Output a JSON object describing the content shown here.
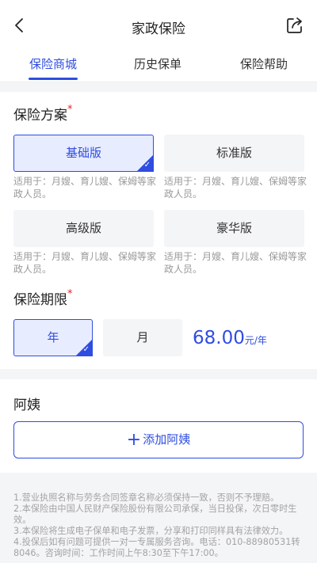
{
  "header": {
    "title": "家政保险"
  },
  "tabs": [
    "保险商城",
    "历史保单",
    "保险帮助"
  ],
  "plan": {
    "title": "保险方案",
    "required_mark": "*",
    "options": [
      {
        "label": "基础版",
        "desc": "适用于：月嫂、育儿嫂、保姆等家政人员。",
        "selected": true
      },
      {
        "label": "标准版",
        "desc": "适用于：月嫂、育儿嫂、保姆等家政人员。",
        "selected": false
      },
      {
        "label": "高级版",
        "desc": "适用于：月嫂、育儿嫂、保姆等家政人员。",
        "selected": false
      },
      {
        "label": "豪华版",
        "desc": "适用于：月嫂、育儿嫂、保姆等家政人员。",
        "selected": false
      }
    ]
  },
  "term": {
    "title": "保险期限",
    "required_mark": "*",
    "options": [
      {
        "label": "年",
        "selected": true
      },
      {
        "label": "月",
        "selected": false
      }
    ],
    "price": "68.00",
    "unit": "元/年"
  },
  "aunt": {
    "title": "阿姨",
    "add_label": "添加阿姨"
  },
  "notes": [
    "1.营业执照名称与劳务合同签章名称必须保持一致，否则不予理赔。",
    "2.本保险由中国人民财产保险股份有限公司承保，当日投保，次日零时生效。",
    "3.本保险将生成电子保单和电子发票，分享和打印同样具有法律效力。",
    "4.投保后如有问题可提供一对一专属服务咨询。电话：010-88980531转8046。咨询时间：工作时间上午8:30至下午17:00。"
  ],
  "colors": {
    "accent": "#2f4de0",
    "required": "#e0252b"
  }
}
